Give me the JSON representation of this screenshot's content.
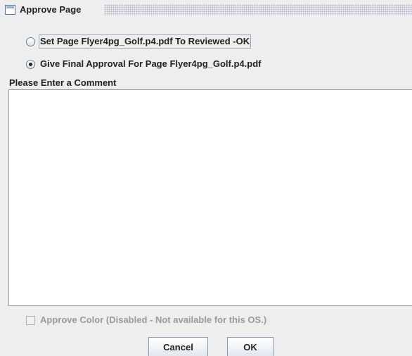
{
  "window": {
    "title": "Approve Page",
    "icon": "window-icon"
  },
  "options": [
    {
      "label": "Set Page Flyer4pg_Golf.p4.pdf To Reviewed -OK",
      "selected": false
    },
    {
      "label": "Give Final Approval For Page Flyer4pg_Golf.p4.pdf",
      "selected": true
    }
  ],
  "comment": {
    "label": "Please Enter a Comment",
    "value": ""
  },
  "approve_color": {
    "label": "Approve Color (Disabled - Not available for this OS.)",
    "checked": false,
    "disabled": true
  },
  "buttons": {
    "cancel": "Cancel",
    "ok": "OK"
  }
}
